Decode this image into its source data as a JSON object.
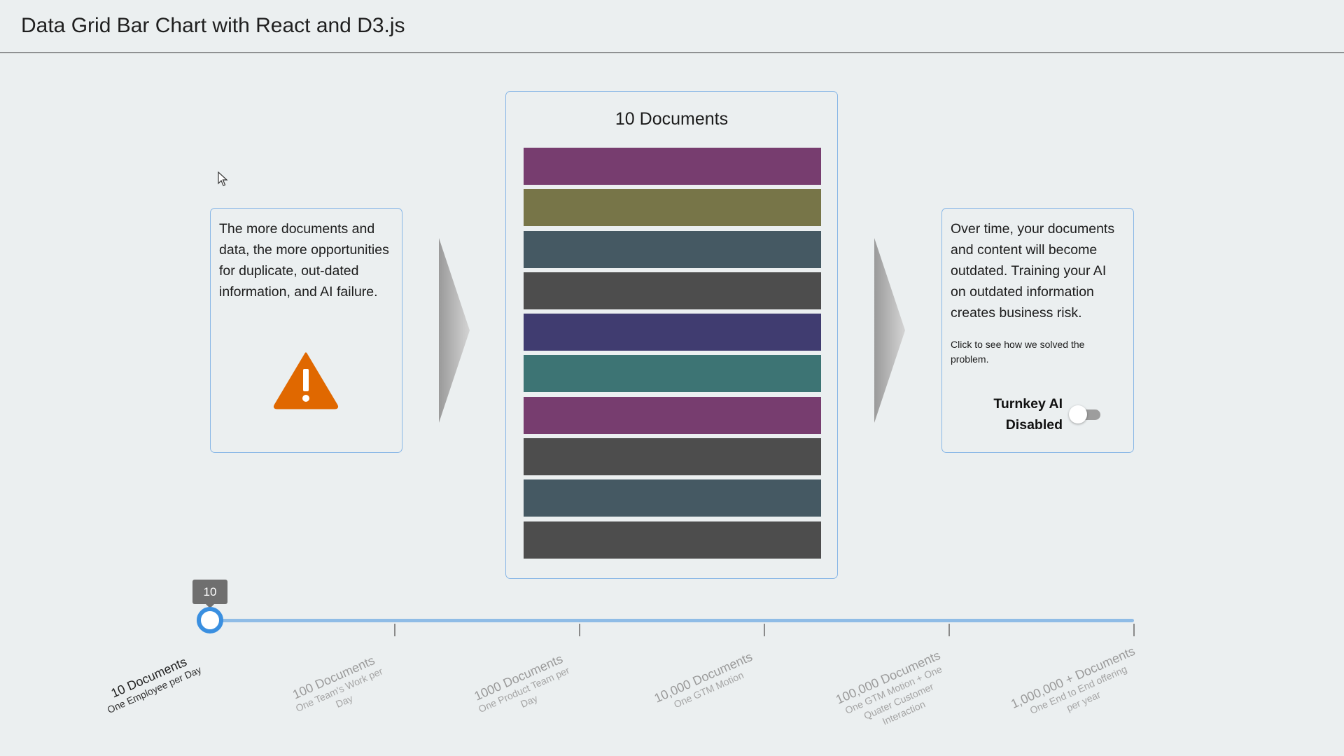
{
  "header": {
    "title": "Data Grid Bar Chart with React and D3.js"
  },
  "left_card": {
    "text": "The more documents and data, the more opportunities for duplicate, out-dated information, and AI failure.",
    "icon": "warning-icon",
    "icon_color": "#e06800"
  },
  "documents_card": {
    "title": "10 Documents",
    "bar_colors": [
      "#773d6f",
      "#777548",
      "#455963",
      "#4d4d4d",
      "#403c70",
      "#3d7474",
      "#773d6f",
      "#4d4d4d",
      "#455963",
      "#4d4d4d"
    ]
  },
  "right_card": {
    "text": "Over time, your documents and content will become outdated. Training your AI on outdated information creates business risk.",
    "hint": "Click to see how we solved the problem.",
    "toggle_label_line1": "Turnkey AI",
    "toggle_label_line2": "Disabled",
    "toggle_on": false
  },
  "slider": {
    "value": "10",
    "selected_index": 0,
    "ticks": [
      {
        "label": "10 Documents",
        "sub": "One Employee per Day"
      },
      {
        "label": "100 Documents",
        "sub": "One Team's Work per Day"
      },
      {
        "label": "1000 Documents",
        "sub": "One Product Team per Day"
      },
      {
        "label": "10,000 Documents",
        "sub": "One GTM Motion"
      },
      {
        "label": "100,000 Documents",
        "sub": "One GTM Motion + One Quater Customer Interaction"
      },
      {
        "label": "1,000,000 + Documents",
        "sub": "One End to End offering per year"
      }
    ]
  },
  "colors": {
    "accent": "#3a8fe0",
    "track": "#8fbce6",
    "card_border": "#87b6e6",
    "background": "#ebeff0"
  }
}
